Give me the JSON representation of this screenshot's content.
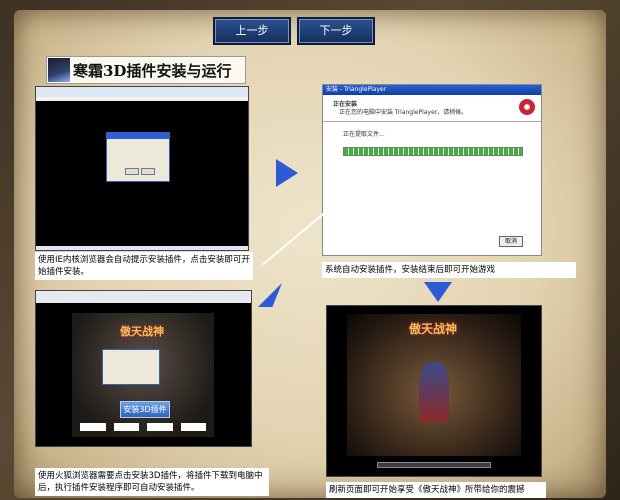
{
  "nav": {
    "prev_label": "上一步",
    "next_label": "下一步"
  },
  "title": "寒霜3D插件安装与运行",
  "steps": [
    {
      "caption": "使用IE内核浏览器会自动提示安装插件，点击安装即可开始插件安装。"
    },
    {
      "caption": "系统自动安装插件，安装结束后即可开始游戏"
    },
    {
      "caption": "使用火狐浏览器需要点击安装3D插件，将插件下载到电脑中后，执行插件安装程序即可自动安装插件。"
    },
    {
      "caption": "刷新页面即可开始享受《傲天战神》所带给你的震撼"
    }
  ],
  "installer": {
    "window_title": "安装 - TrianglePlayer",
    "heading": "正在安装",
    "subheading": "正在您的电脑中安装 TrianglePlayer，请稍候。",
    "status": "正在提取文件...",
    "cancel_label": "取消"
  },
  "firefox_page": {
    "install_button": "安装3D插件",
    "game_logo": "傲天战神"
  },
  "game": {
    "logo": "傲天战神"
  },
  "colors": {
    "arrow": "#2b5bd6",
    "nav_button": "#1f3f78"
  }
}
